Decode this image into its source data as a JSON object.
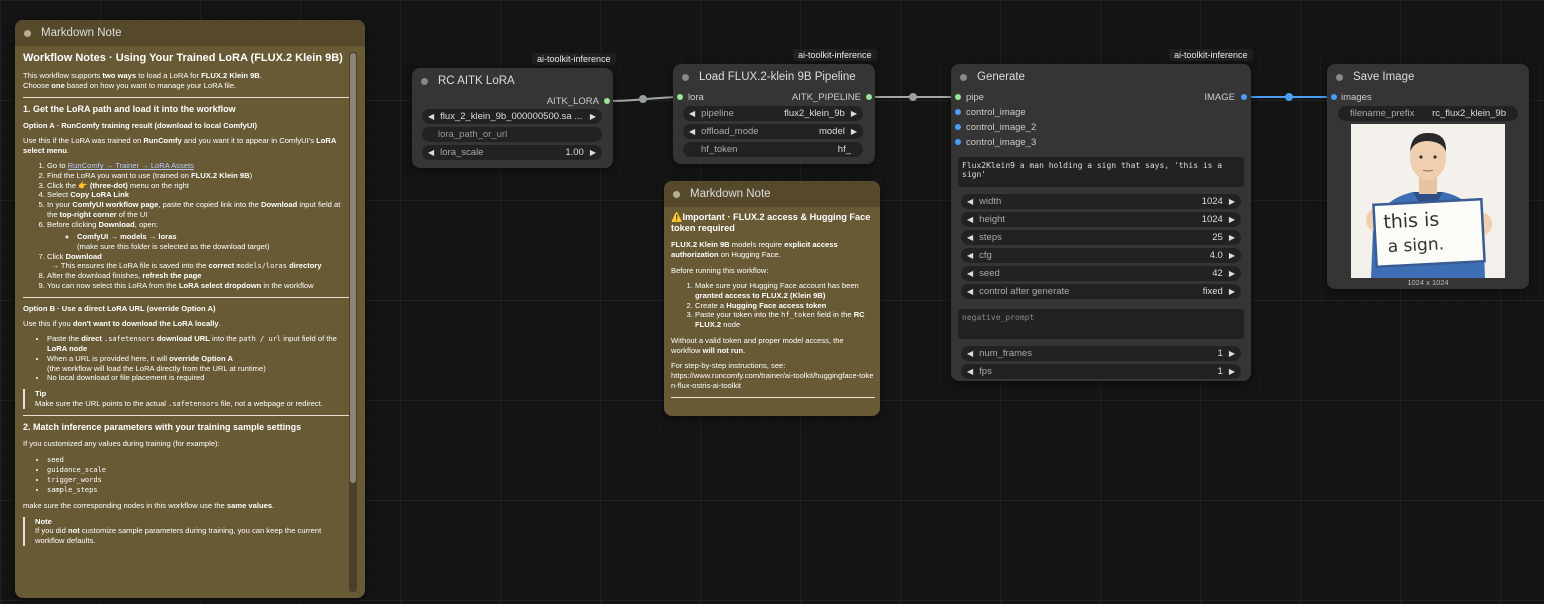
{
  "badges": {
    "lora": "ai-toolkit-inference",
    "pipeline": "ai-toolkit-inference",
    "generate": "ai-toolkit-inference"
  },
  "markdown_note_1": {
    "title": "Markdown Note",
    "h1": "Workflow Notes · Using Your Trained LoRA (FLUX.2 Klein 9B)",
    "intro_1": "This workflow supports ",
    "intro_bold_1": "two ways",
    "intro_2": " to load a LoRA for ",
    "intro_bold_2": "FLUX.2 Klein 9B",
    "intro_3": ".",
    "intro_line2_a": "Choose ",
    "intro_line2_bold": "one",
    "intro_line2_b": " based on how you want to manage your LoRA file.",
    "sec1": "1. Get the LoRA path and load it into the workflow",
    "optA_title": "Option A · RunComfy training result (download to local ComfyUI)",
    "optA_use_1": "Use this if the LoRA was trained on ",
    "optA_use_bold1": "RunComfy",
    "optA_use_2": " and you want it to appear in ComfyUI's ",
    "optA_use_bold2": "LoRA select menu",
    "optA_use_3": ".",
    "step1_a": "Go to ",
    "step1_link": "RunComfy → Trainer → LoRA Assets",
    "step2_a": "Find the LoRA you want to use (trained on ",
    "step2_bold": "FLUX.2 Klein 9B",
    "step2_b": ")",
    "step3_a": "Click the ",
    "step3_icon": "👉",
    "step3_bold": " (three-dot)",
    "step3_b": " menu on the right",
    "step4_a": "Select ",
    "step4_bold": "Copy LoRA Link",
    "step5_a": "In your ",
    "step5_bold1": "ComfyUI workflow page",
    "step5_b": ", paste the copied link into the ",
    "step5_bold2": "Download",
    "step5_c": " input field at the ",
    "step5_bold3": "top-right corner",
    "step5_d": " of the UI",
    "step6_a": "Before clicking ",
    "step6_bold": "Download",
    "step6_b": ", open:",
    "step6_sub_bold": "ComfyUI → models → loras",
    "step6_sub_note": "(make sure this folder is selected as the download target)",
    "step7_a": "Click ",
    "step7_bold": "Download",
    "step7_sub_a": "→ This ensures the LoRA file is saved into the ",
    "step7_sub_bold": "correct ",
    "step7_sub_code": "models/loras",
    "step7_sub_bold2": " directory",
    "step8_a": "After the download finishes, ",
    "step8_bold": "refresh the page",
    "step9_a": "You can now select this LoRA from the ",
    "step9_bold": "LoRA select dropdown",
    "step9_b": " in the workflow",
    "optB_title": "Option B · Use a direct LoRA URL (override Option A)",
    "optB_use_a": "Use this if you ",
    "optB_use_bold": "don't want to download the LoRA locally",
    "optB_use_b": ".",
    "optB_b1_a": "Paste the ",
    "optB_b1_bold1": "direct ",
    "optB_b1_code1": ".safetensors",
    "optB_b1_bold2": " download URL",
    "optB_b1_b": " into the ",
    "optB_b1_code2": "path / url",
    "optB_b1_c": " input field of the ",
    "optB_b1_bold3": "LoRA node",
    "optB_b2_a": "When a URL is provided here, it will ",
    "optB_b2_bold": "override Option A",
    "optB_b2_sub": "(the workflow will load the LoRA directly from the URL at runtime)",
    "optB_b3": "No local download or file placement is required",
    "tip_title": "Tip",
    "tip_a": "Make sure the URL points to the actual ",
    "tip_code": ".safetensors",
    "tip_b": " file, not a webpage or redirect.",
    "sec2": "2. Match inference parameters with your training sample settings",
    "sec2_p": "If you customized any values during training (for example):",
    "sec2_items": [
      "seed",
      "guidance_scale",
      "trigger_words",
      "sample_steps"
    ],
    "sec2_after_a": "make sure the corresponding nodes in this workflow use the ",
    "sec2_after_bold": "same values",
    "sec2_after_b": ".",
    "note_title": "Note",
    "note_a": "If you did ",
    "note_bold": "not",
    "note_b": " customize sample parameters during training, you can keep the current workflow defaults."
  },
  "lora_node": {
    "title": "RC AITK LoRA",
    "output": "AITK_LORA",
    "lora_name": "flux_2_klein_9b_000000500.sa ...",
    "path_placeholder": "lora_path_or_url",
    "scale_label": "lora_scale",
    "scale_value": "1.00"
  },
  "pipeline_node": {
    "title": "Load FLUX.2-klein 9B Pipeline",
    "input": "lora",
    "output": "AITK_PIPELINE",
    "pipeline_label": "pipeline",
    "pipeline_value": "flux2_klein_9b",
    "offload_label": "offload_mode",
    "offload_value": "model",
    "hf_label": "hf_token",
    "hf_value": "hf_"
  },
  "markdown_note_2": {
    "title": "Markdown Note",
    "h1_icon": "⚠️",
    "h1": "Important · FLUX.2 access & Hugging Face token required",
    "p1_bold1": "FLUX.2 Klein 9B",
    "p1_a": " models require ",
    "p1_bold2": "explicit access authorization",
    "p1_b": " on Hugging Face.",
    "p2": "Before running this workflow:",
    "li1_a": "Make sure your Hugging Face account has been ",
    "li1_bold": "granted access to FLUX.2 (Klein 9B)",
    "li2_a": "Create a ",
    "li2_bold": "Hugging Face access token",
    "li3_a": "Paste your token into the ",
    "li3_code": "hf_token",
    "li3_b": " field in the ",
    "li3_bold": "RC FLUX.2",
    "li3_c": " node",
    "p3_a": "Without a valid token and proper model access, the workflow ",
    "p3_bold": "will not run",
    "p3_b": ".",
    "p4": "For step-by-step instructions, see:",
    "p4_url": "https://www.runcomfy.com/trainer/ai-toolkit/huggingface-token-flux-ostris-ai-toolkit"
  },
  "generate_node": {
    "title": "Generate",
    "inputs": [
      "pipe",
      "control_image",
      "control_image_2",
      "control_image_3"
    ],
    "output": "IMAGE",
    "prompt": "Flux2Klein9 a man holding a sign that says, 'this is a sign'",
    "negative_placeholder": "negative_prompt",
    "widgets": [
      {
        "label": "width",
        "value": "1024"
      },
      {
        "label": "height",
        "value": "1024"
      },
      {
        "label": "steps",
        "value": "25"
      },
      {
        "label": "cfg",
        "value": "4.0"
      },
      {
        "label": "seed",
        "value": "42"
      },
      {
        "label": "control after generate",
        "value": "fixed"
      }
    ],
    "widgets2": [
      {
        "label": "num_frames",
        "value": "1"
      },
      {
        "label": "fps",
        "value": "1"
      }
    ]
  },
  "save_node": {
    "title": "Save Image",
    "input": "images",
    "prefix_label": "filename_prefix",
    "prefix_value": "rc_flux2_klein_9b",
    "sign_line1": "this is",
    "sign_line2": "a sign.",
    "image_size": "1024 x 1024"
  },
  "colors": {
    "lora_link": "#9be59b",
    "image_link": "#4a9ff5",
    "note_bg": "#675a35"
  }
}
